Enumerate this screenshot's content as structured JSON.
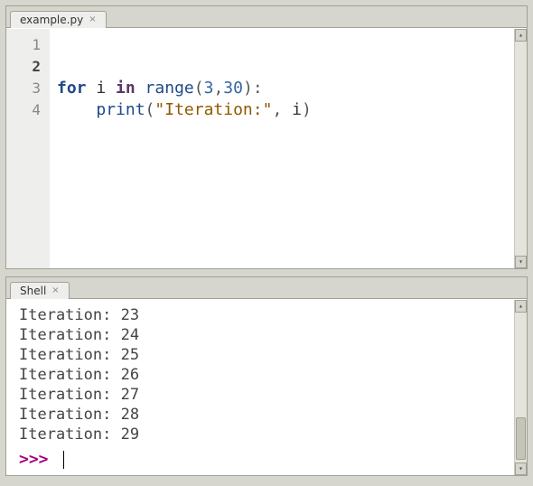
{
  "editor": {
    "tab_label": "example.py",
    "line_numbers": [
      "1",
      "2",
      "3",
      "4"
    ],
    "current_line": "2",
    "code": {
      "l3_kw_for": "for",
      "l3_var": " i ",
      "l3_kw_in": "in",
      "l3_fn_range": " range",
      "l3_open": "(",
      "l3_arg1": "3",
      "l3_comma": ",",
      "l3_arg2": "30",
      "l3_close": ")",
      "l3_colon": ":",
      "l4_indent": "    ",
      "l4_fn_print": "print",
      "l4_open": "(",
      "l4_str": "\"Iteration:\"",
      "l4_comma": ",",
      "l4_arg": " i",
      "l4_close": ")"
    }
  },
  "shell": {
    "tab_label": "Shell",
    "output": [
      "Iteration: 23",
      "Iteration: 24",
      "Iteration: 25",
      "Iteration: 26",
      "Iteration: 27",
      "Iteration: 28",
      "Iteration: 29"
    ],
    "prompt": ">>> "
  }
}
